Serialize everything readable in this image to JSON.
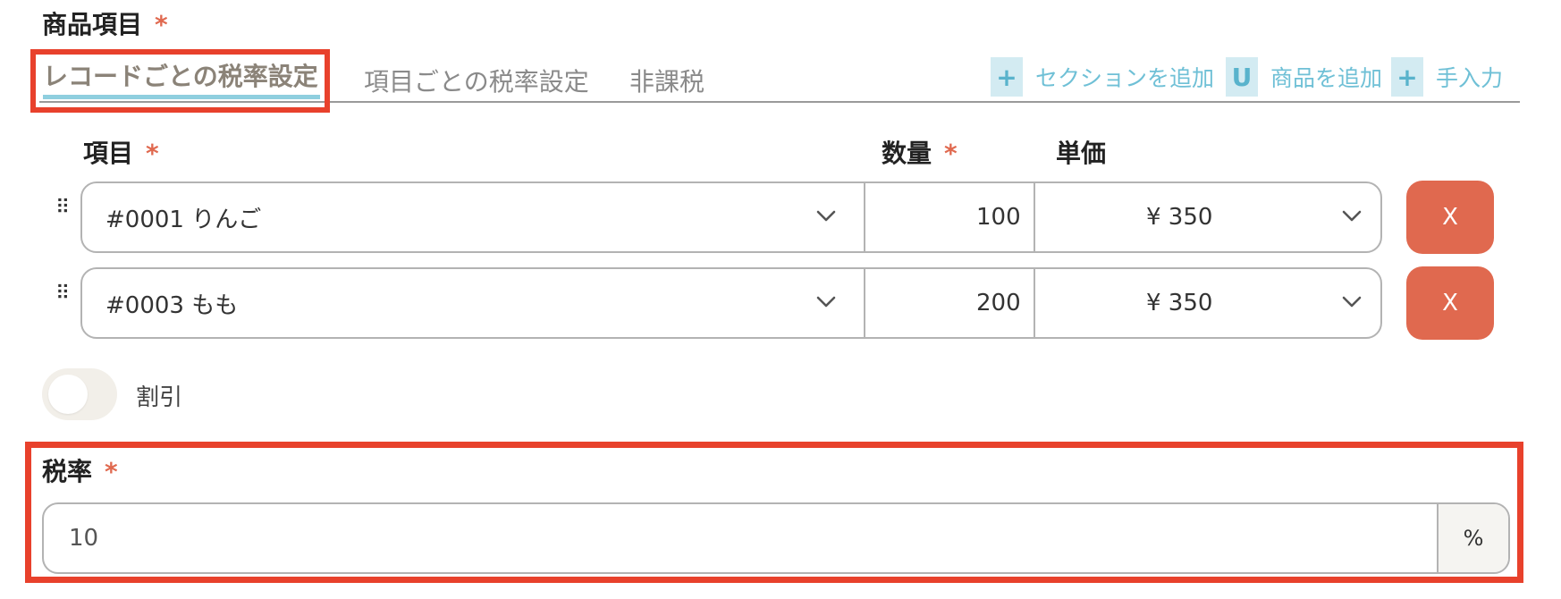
{
  "section": {
    "title": "商品項目",
    "required_mark": "*"
  },
  "tabs": [
    {
      "label": "レコードごとの税率設定",
      "active": true
    },
    {
      "label": "項目ごとの税率設定",
      "active": false
    },
    {
      "label": "非課税",
      "active": false
    }
  ],
  "actions": [
    {
      "label": "セクションを追加",
      "icon": "+",
      "icon_name": "add-document-icon"
    },
    {
      "label": "商品を追加",
      "icon": "U",
      "icon_name": "product-icon"
    },
    {
      "label": "手入力",
      "icon": "+",
      "icon_name": "add-document-icon"
    }
  ],
  "columns": {
    "item": "項目",
    "quantity": "数量",
    "unit_price": "単価",
    "required_mark": "*"
  },
  "rows": [
    {
      "item": "#0001 りんご",
      "quantity": "100",
      "price": "¥ 350",
      "delete_label": "X"
    },
    {
      "item": "#0003 もも",
      "quantity": "200",
      "price": "¥ 350",
      "delete_label": "X"
    }
  ],
  "discount": {
    "label": "割引",
    "enabled": false
  },
  "tax": {
    "label": "税率",
    "required_mark": "*",
    "value": "10",
    "suffix": "%"
  },
  "colors": {
    "accent_red": "#e0694f",
    "highlight_red": "#e8412c",
    "link_blue": "#6fc0d6",
    "tab_underline": "#8fcfdf",
    "border_gray": "#b3b3b3"
  }
}
